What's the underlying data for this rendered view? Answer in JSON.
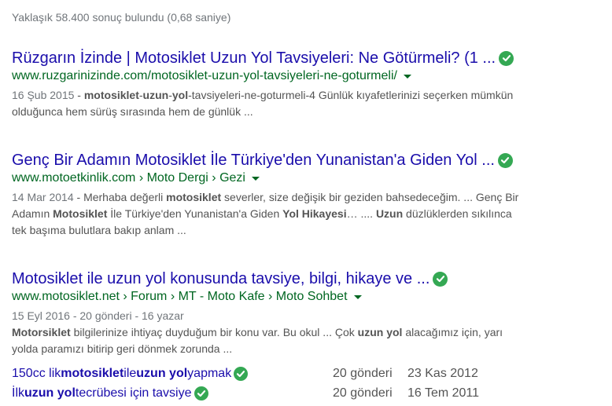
{
  "stats": "Yaklaşık 58.400 sonuç bulundu (0,68 saniye)",
  "results": [
    {
      "title": "Rüzgarın İzinde | Motosiklet Uzun Yol Tavsiyeleri: Ne Götürmeli? (1 ...",
      "url": "www.ruzgarinizinde.com/motosiklet-uzun-yol-tavsiyeleri-ne-goturmeli/",
      "date": "16 Şub 2015",
      "dash": " - ",
      "bold1": "motosiklet",
      "t1": "-",
      "bold2": "uzun",
      "t2": "-",
      "bold3": "yol",
      "t3": "-tavsiyeleri-ne-goturmeli-4 Günlük kıyafetlerinizi seçerken mümkün",
      "line2": "olduğunca hem sürüş sırasında hem de günlük ..."
    },
    {
      "title": "Genç Bir Adamın Motosiklet İle Türkiye'den Yunanistan'a Giden Yol ...",
      "url": "www.motoetkinlik.com › Moto Dergi › Gezi",
      "date": "14 Mar 2014",
      "dash": " - ",
      "t1": "Merhaba değerli ",
      "bold1": "motosiklet",
      "t2": " severler, size değişik bir geziden bahsedeceğim. ... Genç Bir",
      "l2a": "Adamın ",
      "l2b": "Motosiklet",
      "l2c": " İle Türkiye'den Yunanistan'a Giden ",
      "l2d": "Yol Hikayesi",
      "l2e": "… .... ",
      "l2f": "Uzun",
      "l2g": " düzlüklerden sıkılınca",
      "line3": "tek başıma bulutlara bakıp anlam ..."
    },
    {
      "title": "Motosiklet ile uzun yol konusunda tavsiye, bilgi, hikaye ve ...",
      "url": "www.motosiklet.net › Forum › MT - Moto Kafe › Moto Sohbet",
      "meta": "15 Eyl 2016 - 20 gönderi - 16 yazar",
      "l1a": "Motorsiklet",
      "l1b": " bilgilerinize ihtiyaç duyduğum bir konu var. Bu okul ... Çok ",
      "l1c": "uzun yol",
      "l1d": " alacağımız için, yarı",
      "line2": "yolda paramızı bitirip geri dönmek zorunda ..."
    }
  ],
  "sitelinks": [
    {
      "a": "150cc lik ",
      "b": "motosiklet",
      "c": " ile ",
      "d": "uzun yol",
      "e": " yapmak",
      "posts": "20 gönderi",
      "date": "23 Kas 2012"
    },
    {
      "a": "İlk ",
      "b": "uzun yol",
      "c": " tecrübesi için tavsiye",
      "d": "",
      "e": "",
      "posts": "20 gönderi",
      "date": "16 Tem 2011"
    }
  ],
  "colors": {
    "title": "#1a0dab",
    "url": "#006621",
    "check": "#34a853"
  },
  "icons": {
    "verified": "check-circle-icon",
    "menu": "caret-down-icon"
  }
}
